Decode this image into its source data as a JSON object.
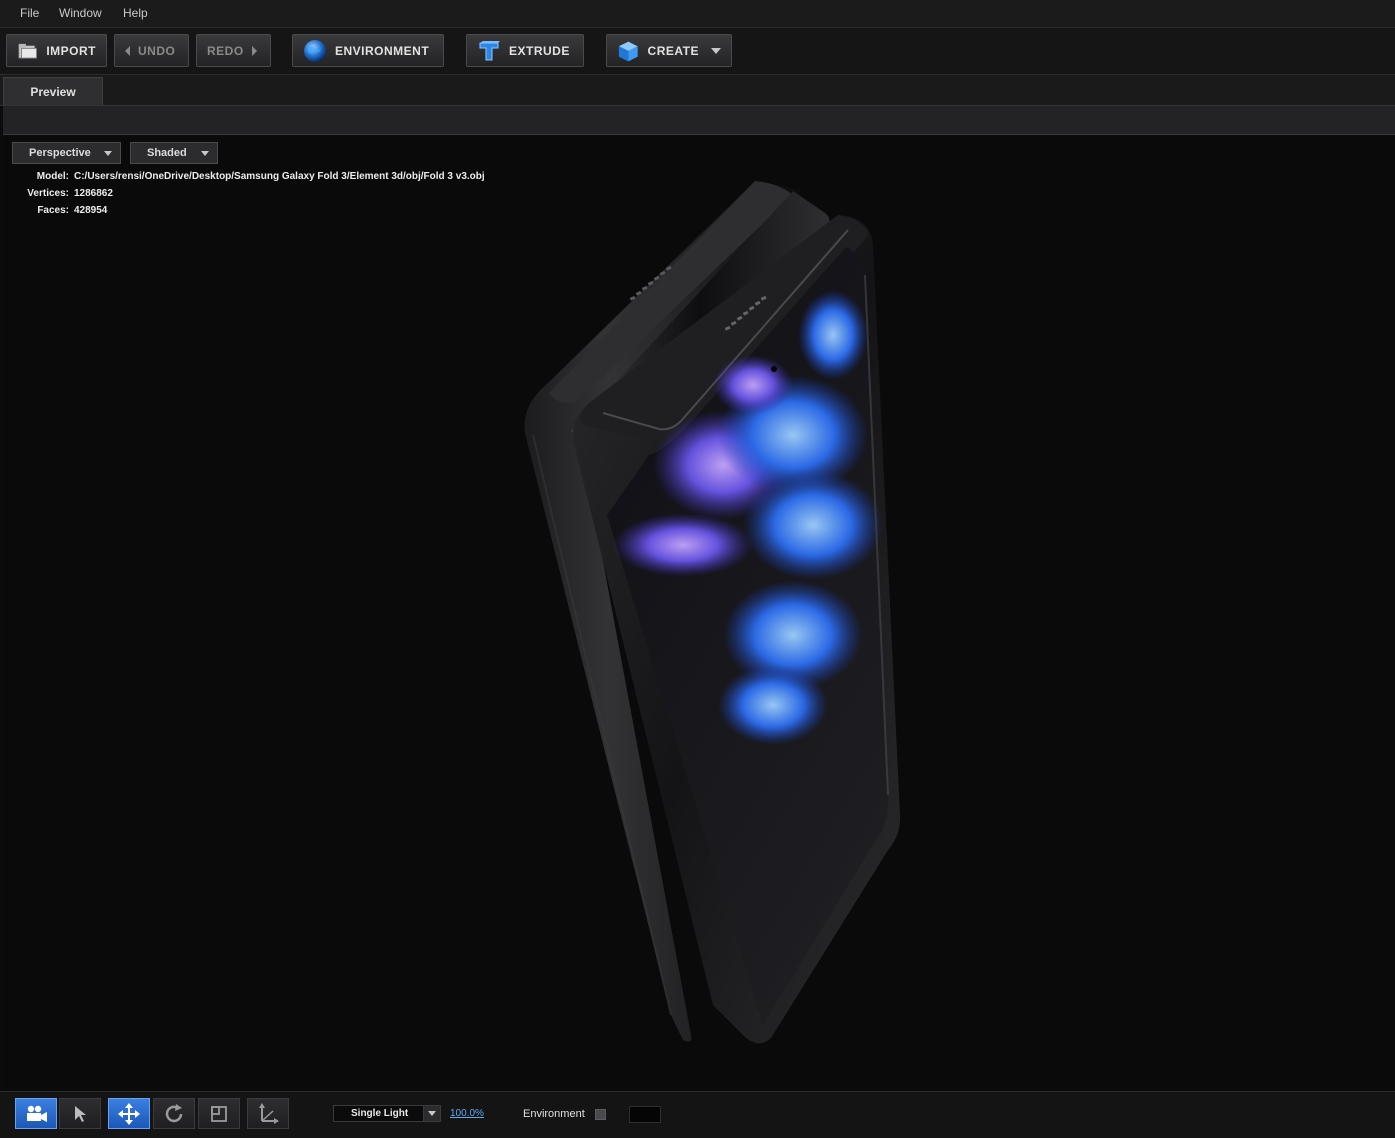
{
  "menu": {
    "file": "File",
    "window": "Window",
    "help": "Help"
  },
  "toolbar": {
    "import": "IMPORT",
    "undo": "UNDO",
    "redo": "REDO",
    "environment": "ENVIRONMENT",
    "extrude": "EXTRUDE",
    "create": "CREATE"
  },
  "tabs": {
    "preview": "Preview"
  },
  "viewport": {
    "camera_mode": "Perspective",
    "shading_mode": "Shaded",
    "info": {
      "model_label": "Model:",
      "model_value": "C:/Users/rensi/OneDrive/Desktop/Samsung Galaxy Fold 3/Element 3d/obj/Fold 3 v3.obj",
      "vertices_label": "Vertices:",
      "vertices_value": "1286862",
      "faces_label": "Faces:",
      "faces_value": "428954"
    }
  },
  "bottom": {
    "light_mode": "Single Light",
    "light_intensity": "100.0%",
    "environment_label": "Environment",
    "environment_checked": false
  },
  "colors": {
    "accent": "#2e6fd0",
    "link": "#62a8f0",
    "background": "#0a0a0b"
  }
}
